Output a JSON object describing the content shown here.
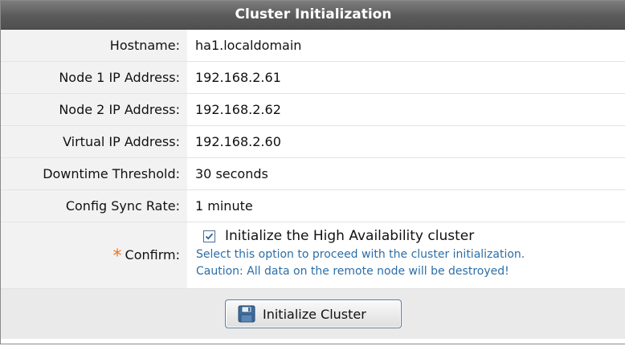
{
  "title": "Cluster Initialization",
  "rows": [
    {
      "label": "Hostname:",
      "value": "ha1.localdomain"
    },
    {
      "label": "Node 1 IP Address:",
      "value": "192.168.2.61"
    },
    {
      "label": "Node 2 IP Address:",
      "value": "192.168.2.62"
    },
    {
      "label": "Virtual IP Address:",
      "value": "192.168.2.60"
    },
    {
      "label": "Downtime Threshold:",
      "value": "30 seconds"
    },
    {
      "label": "Config Sync Rate:",
      "value": "1 minute"
    }
  ],
  "confirm": {
    "required_marker": "*",
    "label": "Confirm:",
    "checkbox_label": "Initialize the High Availability cluster",
    "checked": true,
    "help_line1": "Select this option to proceed with the cluster initialization.",
    "help_line2": "Caution: All data on the remote node will be destroyed!"
  },
  "button": {
    "label": "Initialize Cluster",
    "icon": "floppy-disk-icon"
  },
  "colors": {
    "title_bg": "#5a5a5a",
    "label_bg": "#f2f2f2",
    "help_text": "#2c6ea8",
    "required": "#f0721e"
  }
}
